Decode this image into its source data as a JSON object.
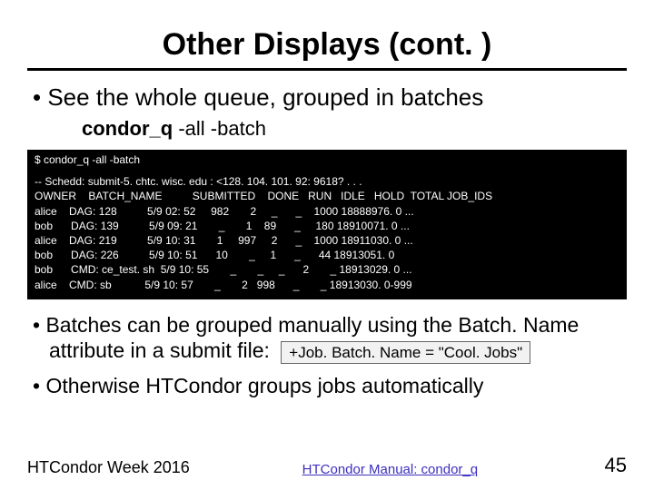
{
  "title": "Other Displays (cont. )",
  "bullet1": "See the whole queue, grouped in batches",
  "command_display": {
    "bold": "condor_q",
    "rest": " -all -batch"
  },
  "terminal": {
    "prompt": "$ condor_q -all -batch",
    "lines": [
      "-- Schedd: submit-5. chtc. wisc. edu : <128. 104. 101. 92: 9618? . . .",
      "OWNER    BATCH_NAME          SUBMITTED    DONE   RUN   IDLE   HOLD  TOTAL JOB_IDS",
      "alice    DAG: 128          5/9 02: 52     982       2     _      _    1000 18888976. 0 ...",
      "bob      DAG: 139          5/9 09: 21       _       1    89      _     180 18910071. 0 ...",
      "alice    DAG: 219          5/9 10: 31       1     997     2      _    1000 18911030. 0 ...",
      "bob      DAG: 226          5/9 10: 51      10       _     1      _      44 18913051. 0",
      "bob      CMD: ce_test. sh  5/9 10: 55       _       _     _      2       _ 18913029. 0 ...",
      "alice    CMD: sb           5/9 10: 57       _       2   998      _       _ 18913030. 0-999"
    ]
  },
  "bullet2_part1": "Batches can be grouped manually using the Batch. Name attribute in a submit file:",
  "attr_box": "+Job. Batch. Name = \"Cool. Jobs\"",
  "bullet3": "Otherwise HTCondor groups jobs automatically",
  "footer": {
    "left": "HTCondor Week 2016",
    "center": "HTCondor Manual: condor_q",
    "right": "45"
  },
  "chart_data": {
    "type": "table",
    "title": "condor_q -all -batch output",
    "columns": [
      "OWNER",
      "BATCH_NAME",
      "SUBMITTED",
      "DONE",
      "RUN",
      "IDLE",
      "HOLD",
      "TOTAL",
      "JOB_IDS"
    ],
    "rows": [
      [
        "alice",
        "DAG: 128",
        "5/9 02:52",
        982,
        2,
        null,
        null,
        1000,
        "18888976.0 ..."
      ],
      [
        "bob",
        "DAG: 139",
        "5/9 09:21",
        null,
        1,
        89,
        null,
        180,
        "18910071.0 ..."
      ],
      [
        "alice",
        "DAG: 219",
        "5/9 10:31",
        1,
        997,
        2,
        null,
        1000,
        "18911030.0 ..."
      ],
      [
        "bob",
        "DAG: 226",
        "5/9 10:51",
        10,
        null,
        1,
        null,
        44,
        "18913051.0"
      ],
      [
        "bob",
        "CMD: ce_test.sh",
        "5/9 10:55",
        null,
        null,
        null,
        2,
        null,
        "18913029.0 ..."
      ],
      [
        "alice",
        "CMD: sb",
        "5/9 10:57",
        null,
        2,
        998,
        null,
        null,
        "18913030.0-999"
      ]
    ]
  }
}
